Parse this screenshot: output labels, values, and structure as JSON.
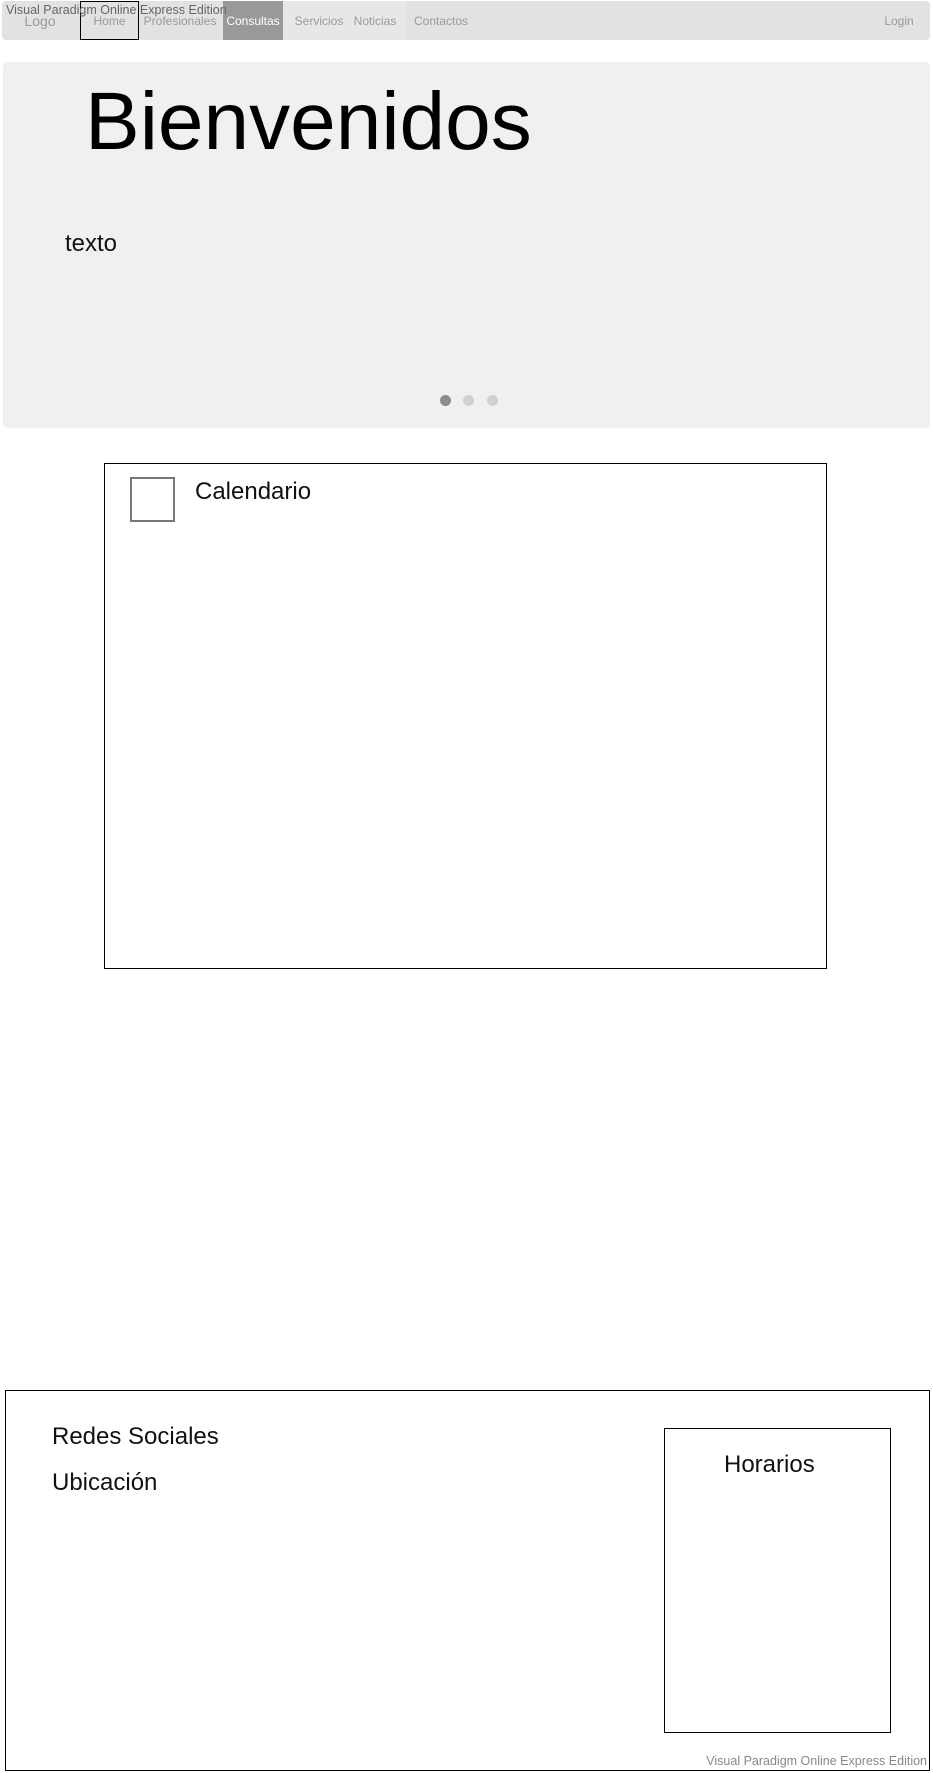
{
  "watermark": "Visual Paradigm Online Express Edition",
  "nav": {
    "logo": "Logo",
    "items": [
      {
        "label": "Home"
      },
      {
        "label": "Profesionales"
      },
      {
        "label": "Consultas",
        "active": true
      },
      {
        "label": "Servicios"
      },
      {
        "label": "Noticias"
      },
      {
        "label": "Contactos"
      }
    ],
    "login": "Login"
  },
  "hero": {
    "title": "Bienvenidos",
    "text": "texto",
    "carousel": {
      "slides": 3,
      "active_index": 0
    }
  },
  "calendar": {
    "title": "Calendario"
  },
  "footer": {
    "social": "Redes Sociales",
    "location": "Ubicación",
    "hours": "Horarios"
  },
  "colors": {
    "nav_bg": "#e2e2e2",
    "active_bg": "#999999",
    "hero_bg": "#f0f0f0"
  }
}
